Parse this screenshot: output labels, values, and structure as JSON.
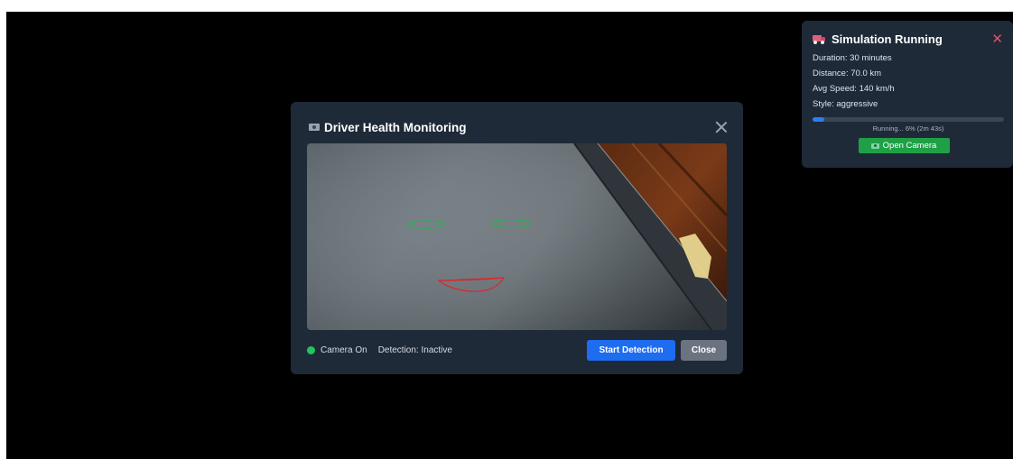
{
  "simulation": {
    "title": "Simulation Running",
    "duration": "Duration: 30 minutes",
    "distance": "Distance: 70.0 km",
    "avg_speed": "Avg Speed: 140 km/h",
    "style": "Style: aggressive",
    "progress": 0.06,
    "progress_text": "Running... 6% (2m 43s)",
    "open_camera_label": "Open Camera",
    "close_glyph": "✕"
  },
  "modal": {
    "title": "Driver Health Monitoring",
    "camera_status": "Camera On",
    "detection_status": "Detection: Inactive",
    "start_label": "Start Detection",
    "close_label": "Close"
  },
  "colors": {
    "background": "#000000",
    "panel": "#1f2a38",
    "primary": "#1e6cf0",
    "success": "#1fa046",
    "danger": "#e0506a",
    "camera_on": "#22c55e"
  },
  "icons": {
    "simulation": "truck-icon",
    "camera": "camera-icon",
    "close": "close-icon"
  }
}
